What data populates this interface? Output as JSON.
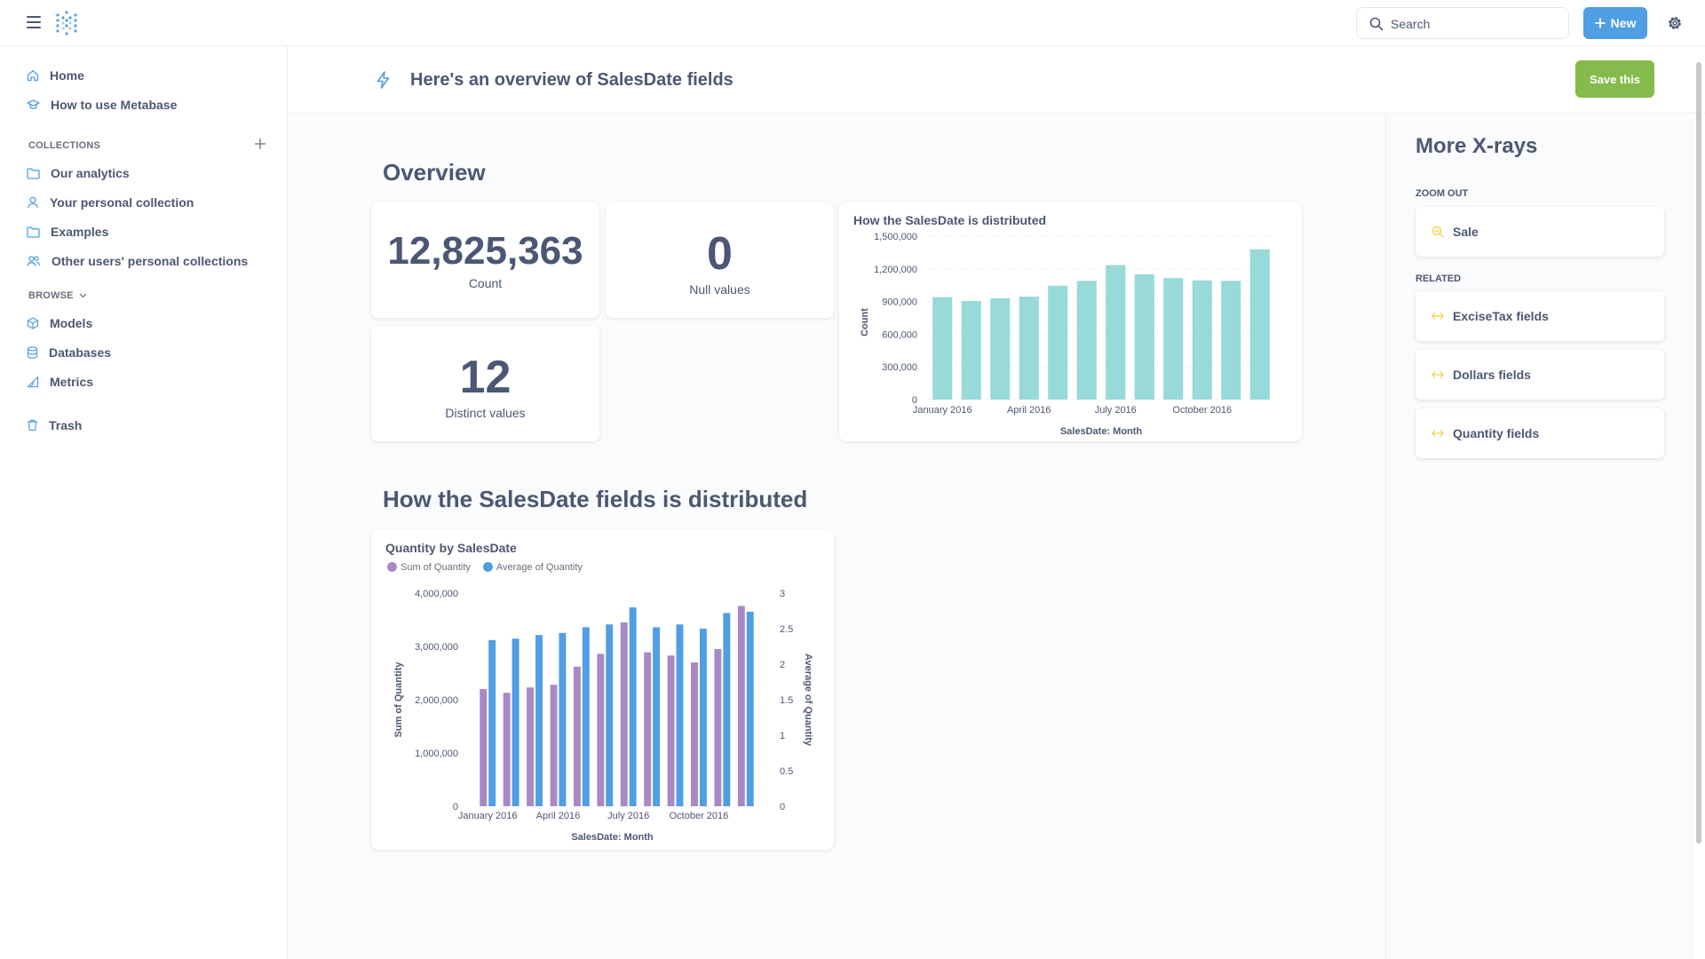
{
  "topbar": {
    "search_placeholder": "Search",
    "new_label": "New"
  },
  "sidebar": {
    "top_items": [
      {
        "label": "Home",
        "icon": "home-icon"
      },
      {
        "label": "How to use Metabase",
        "icon": "graduation-cap-icon"
      }
    ],
    "collections_label": "COLLECTIONS",
    "collections": [
      {
        "label": "Our analytics",
        "icon": "folder-icon"
      },
      {
        "label": "Your personal collection",
        "icon": "person-icon"
      },
      {
        "label": "Examples",
        "icon": "folder-icon"
      },
      {
        "label": "Other users' personal collections",
        "icon": "group-icon"
      }
    ],
    "browse_label": "BROWSE",
    "browse": [
      {
        "label": "Models",
        "icon": "cube-icon"
      },
      {
        "label": "Databases",
        "icon": "database-icon"
      },
      {
        "label": "Metrics",
        "icon": "metric-icon"
      }
    ],
    "trash_label": "Trash"
  },
  "header": {
    "title": "Here's an overview of SalesDate fields",
    "save_label": "Save this"
  },
  "overview": {
    "title": "Overview",
    "count_value": "12,825,363",
    "count_label": "Count",
    "null_value": "0",
    "null_label": "Null values",
    "distinct_value": "12",
    "distinct_label": "Distinct values"
  },
  "distribution": {
    "title": "How the SalesDate fields is distributed"
  },
  "colors": {
    "brand": "#509ee3",
    "save": "#84bb4c",
    "teal_bar": "#98d9d9",
    "purple_bar": "#a989c5",
    "blue_bar": "#509ee3",
    "icon_yellow": "#f9cf48"
  },
  "chart_data": [
    {
      "type": "bar",
      "title": "How the SalesDate is distributed",
      "xlabel": "SalesDate: Month",
      "ylabel": "Count",
      "categories": [
        "January 2016",
        "February 2016",
        "March 2016",
        "April 2016",
        "May 2016",
        "June 2016",
        "July 2016",
        "August 2016",
        "September 2016",
        "October 2016",
        "November 2016",
        "December 2016"
      ],
      "tick_labels": [
        "January 2016",
        "April 2016",
        "July 2016",
        "October 2016"
      ],
      "values": [
        940000,
        905000,
        930000,
        945000,
        1045000,
        1090000,
        1235000,
        1150000,
        1115000,
        1095000,
        1090000,
        1380000
      ],
      "ylim": [
        0,
        1500000
      ],
      "yticks": [
        "0",
        "300,000",
        "600,000",
        "900,000",
        "1,200,000",
        "1,500,000"
      ],
      "grid": true
    },
    {
      "type": "bar",
      "title": "Quantity by SalesDate",
      "xlabel": "SalesDate: Month",
      "ylabel": "Sum of Quantity",
      "ylabel_right": "Average of Quantity",
      "categories": [
        "January 2016",
        "February 2016",
        "March 2016",
        "April 2016",
        "May 2016",
        "June 2016",
        "July 2016",
        "August 2016",
        "September 2016",
        "October 2016",
        "November 2016",
        "December 2016"
      ],
      "tick_labels": [
        "January 2016",
        "April 2016",
        "July 2016",
        "October 2016"
      ],
      "series": [
        {
          "name": "Sum of Quantity",
          "axis": "left",
          "values": [
            2200000,
            2130000,
            2230000,
            2280000,
            2620000,
            2860000,
            3450000,
            2890000,
            2830000,
            2700000,
            2950000,
            3760000
          ]
        },
        {
          "name": "Average of Quantity",
          "axis": "right",
          "values": [
            2.34,
            2.36,
            2.41,
            2.44,
            2.52,
            2.56,
            2.8,
            2.52,
            2.56,
            2.5,
            2.72,
            2.74
          ]
        }
      ],
      "ylim": [
        0,
        4000000
      ],
      "yticks": [
        "0",
        "1,000,000",
        "2,000,000",
        "3,000,000",
        "4,000,000"
      ],
      "ylim_right": [
        0,
        3
      ],
      "yticks_right": [
        "0",
        "0.5",
        "1",
        "1.5",
        "2",
        "2.5",
        "3"
      ],
      "legend": "top-left",
      "grid": false
    }
  ],
  "xrays": {
    "title": "More X-rays",
    "zoom_out_label": "ZOOM OUT",
    "zoom_out": [
      {
        "label": "Sale",
        "icon": "zoom-out-icon"
      }
    ],
    "related_label": "RELATED",
    "related": [
      {
        "label": "ExciseTax fields",
        "icon": "connections-icon"
      },
      {
        "label": "Dollars fields",
        "icon": "connections-icon"
      },
      {
        "label": "Quantity fields",
        "icon": "connections-icon"
      }
    ]
  }
}
